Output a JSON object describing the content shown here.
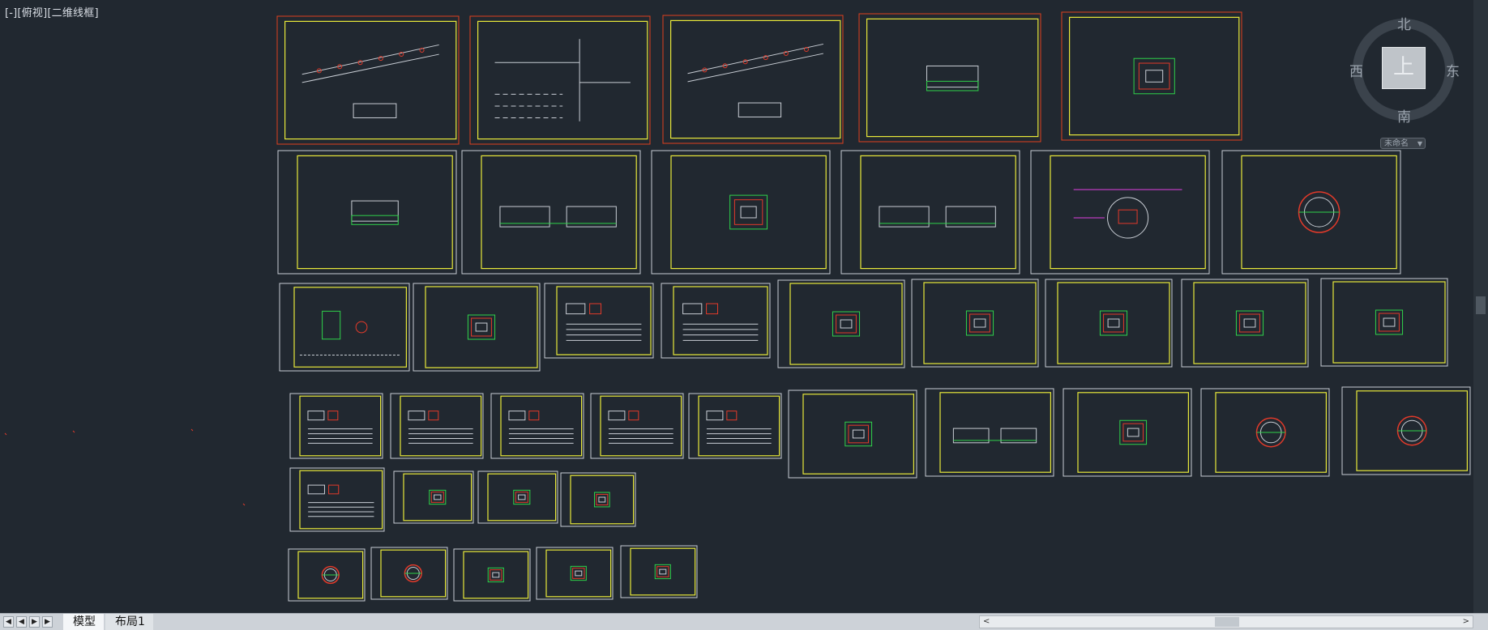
{
  "view_label": "[-][俯视][二维线框]",
  "viewcube": {
    "north": "北",
    "south": "南",
    "west": "西",
    "east": "东",
    "face": "上",
    "ucs": "未命名",
    "ucs_dropdown": "▼"
  },
  "tabs": {
    "model": "模型",
    "layout1": "布局1"
  },
  "nav": {
    "first": "◀",
    "prev": "◀",
    "next": "▶",
    "last": "▶"
  },
  "hscroll": {
    "left": "<",
    "right": ">"
  },
  "colors": {
    "background": "#212830",
    "frame_yellow": "#e8e83a",
    "frame_red": "#e0401e",
    "outline_white": "#c8cdd4",
    "green": "#2fd24a",
    "red": "#e23a2a",
    "magenta": "#e040e0"
  }
}
